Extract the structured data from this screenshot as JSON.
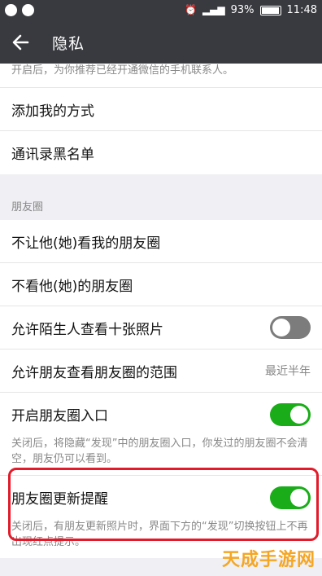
{
  "status_bar": {
    "battery": "93%",
    "time": "11:48",
    "signal": "4G"
  },
  "app_bar": {
    "title": "隐私"
  },
  "top_desc": "开启后，为你推荐已经开通微信的手机联系人。",
  "items_top": [
    {
      "label": "添加我的方式"
    },
    {
      "label": "通讯录黑名单"
    }
  ],
  "moments_section": {
    "header": "朋友圈",
    "rows": [
      {
        "label": "不让他(她)看我的朋友圈"
      },
      {
        "label": "不看他(她)的朋友圈"
      }
    ],
    "stranger_photos": {
      "label": "允许陌生人查看十张照片",
      "enabled": false
    },
    "visible_range": {
      "label": "允许朋友查看朋友圈的范围",
      "value": "最近半年"
    },
    "moments_entry": {
      "label": "开启朋友圈入口",
      "enabled": true,
      "desc": "关闭后，将隐藏“发现”中的朋友圈入口，你发过的朋友圈不会清空，朋友仍可以看到。"
    },
    "update_reminder": {
      "label": "朋友圈更新提醒",
      "enabled": true,
      "desc": "关闭后，有朋友更新照片时，界面下方的“发现”切换按钮上不再出现红点提示。"
    }
  },
  "watermark": "天成手游网",
  "colors": {
    "toggle_on": "#1aad19",
    "toggle_off": "#7c7c7c",
    "highlight": "#e21b2a",
    "bar": "#393a3f"
  }
}
